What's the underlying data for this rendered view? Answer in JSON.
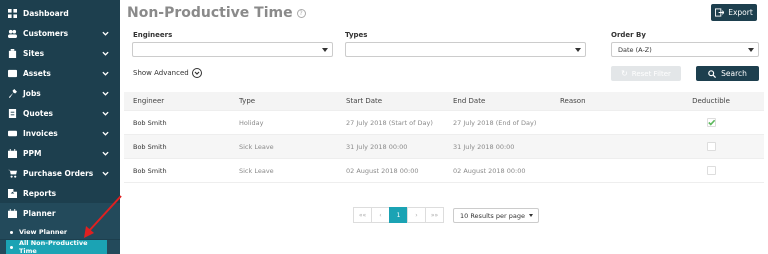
{
  "sidebar": {
    "items": [
      {
        "label": "Dashboard",
        "icon": "dashboard-icon",
        "chevron": false
      },
      {
        "label": "Customers",
        "icon": "users-icon",
        "chevron": true
      },
      {
        "label": "Sites",
        "icon": "building-icon",
        "chevron": true
      },
      {
        "label": "Assets",
        "icon": "assets-icon",
        "chevron": true
      },
      {
        "label": "Jobs",
        "icon": "wrench-icon",
        "chevron": true
      },
      {
        "label": "Quotes",
        "icon": "quote-icon",
        "chevron": true
      },
      {
        "label": "Invoices",
        "icon": "invoice-icon",
        "chevron": true
      },
      {
        "label": "PPM",
        "icon": "calendar-icon",
        "chevron": true
      },
      {
        "label": "Purchase Orders",
        "icon": "cart-icon",
        "chevron": true
      },
      {
        "label": "Reports",
        "icon": "reports-icon",
        "chevron": false
      },
      {
        "label": "Planner",
        "icon": "planner-icon",
        "chevron": false
      }
    ],
    "sub_items": [
      {
        "label": "View Planner"
      },
      {
        "label": "All Non-Productive Time"
      }
    ]
  },
  "header": {
    "title": "Non-Productive Time",
    "export_label": "Export"
  },
  "filters": {
    "engineers_label": "Engineers",
    "engineers_value": "",
    "types_label": "Types",
    "types_value": "",
    "order_by_label": "Order By",
    "order_by_value": "Date (A-Z)",
    "show_advanced_label": "Show Advanced",
    "reset_label": "Reset Filter",
    "search_label": "Search"
  },
  "table": {
    "columns": [
      "Engineer",
      "Type",
      "Start Date",
      "End Date",
      "Reason",
      "Deductible"
    ],
    "rows": [
      {
        "engineer": "Bob Smith",
        "type": "Holiday",
        "start": "27 July 2018 (Start of Day)",
        "end": "27 July 2018 (End of Day)",
        "reason": "",
        "deductible": true
      },
      {
        "engineer": "Bob Smith",
        "type": "Sick Leave",
        "start": "31 July 2018 00:00",
        "end": "31 July 2018 00:00",
        "reason": "",
        "deductible": false
      },
      {
        "engineer": "Bob Smith",
        "type": "Sick Leave",
        "start": "02 August 2018 00:00",
        "end": "02 August 2018 00:00",
        "reason": "",
        "deductible": false
      }
    ]
  },
  "pagination": {
    "first": "««",
    "prev": "‹",
    "current": "1",
    "next": "›",
    "last": "»»",
    "per_page": "10 Results per page"
  },
  "colors": {
    "sidebar_bg": "#1d3f4e",
    "accent": "#1ba3b4",
    "check": "#5cb85c",
    "annotation_arrow": "#e02020"
  }
}
